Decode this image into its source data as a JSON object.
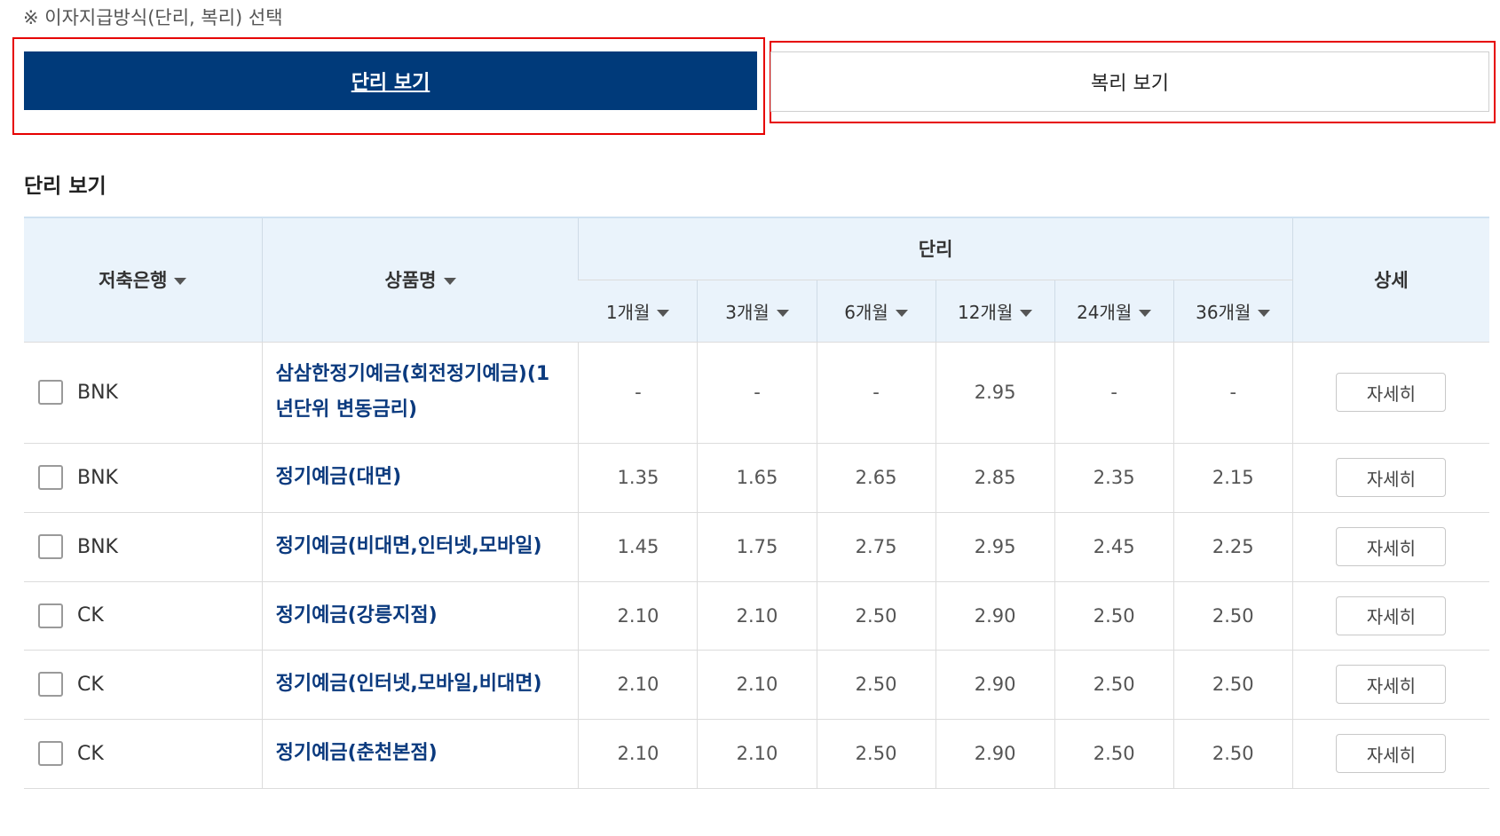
{
  "notice": "※ 이자지급방식(단리, 복리) 선택",
  "tabs": [
    {
      "label": "단리 보기",
      "active": true
    },
    {
      "label": "복리 보기",
      "active": false
    }
  ],
  "section_title": "단리 보기",
  "table": {
    "headers": {
      "bank": "저축은행",
      "product": "상품명",
      "group": "단리",
      "detail": "상세",
      "periods": [
        "1개월",
        "3개월",
        "6개월",
        "12개월",
        "24개월",
        "36개월"
      ]
    },
    "rows": [
      {
        "bank": "BNK",
        "product": "삼삼한정기예금(회전정기예금)(1년단위 변동금리)",
        "rates": [
          "-",
          "-",
          "-",
          "2.95",
          "-",
          "-"
        ],
        "detail": "자세히"
      },
      {
        "bank": "BNK",
        "product": "정기예금(대면)",
        "rates": [
          "1.35",
          "1.65",
          "2.65",
          "2.85",
          "2.35",
          "2.15"
        ],
        "detail": "자세히"
      },
      {
        "bank": "BNK",
        "product": "정기예금(비대면,인터넷,모바일)",
        "rates": [
          "1.45",
          "1.75",
          "2.75",
          "2.95",
          "2.45",
          "2.25"
        ],
        "detail": "자세히"
      },
      {
        "bank": "CK",
        "product": "정기예금(강릉지점)",
        "rates": [
          "2.10",
          "2.10",
          "2.50",
          "2.90",
          "2.50",
          "2.50"
        ],
        "detail": "자세히"
      },
      {
        "bank": "CK",
        "product": "정기예금(인터넷,모바일,비대면)",
        "rates": [
          "2.10",
          "2.10",
          "2.50",
          "2.90",
          "2.50",
          "2.50"
        ],
        "detail": "자세히"
      },
      {
        "bank": "CK",
        "product": "정기예금(춘천본점)",
        "rates": [
          "2.10",
          "2.10",
          "2.50",
          "2.90",
          "2.50",
          "2.50"
        ],
        "detail": "자세히"
      }
    ]
  },
  "colors": {
    "accent": "#003a7a",
    "highlight": "#e60000",
    "header_bg": "#eaf3fb",
    "link": "#0b3a7e"
  }
}
